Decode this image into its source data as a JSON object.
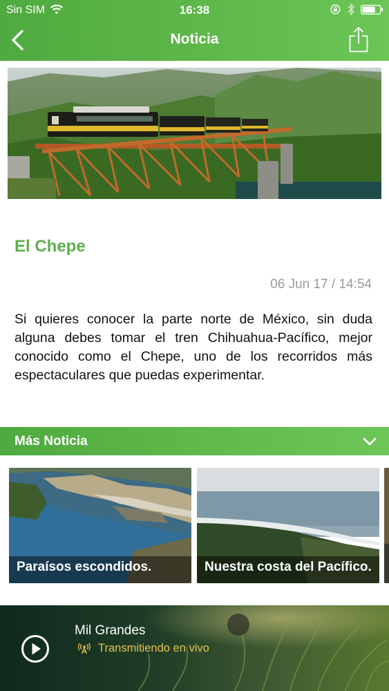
{
  "status_bar": {
    "carrier": "Sin SIM",
    "time": "16:38",
    "icons": [
      "wifi-icon",
      "orientation-lock-icon",
      "bluetooth-icon",
      "battery-icon"
    ]
  },
  "nav": {
    "title": "Noticia",
    "back_icon": "chevron-left-icon",
    "share_icon": "share-icon"
  },
  "article": {
    "title": "El Chepe",
    "date": "06 Jun 17 / 14:54",
    "body": "Si quieres conocer la parte norte de México, sin duda alguna debes tomar el tren Chihuahua-Pacífico, mejor conocido como el Chepe, uno de los recorridos más espectaculares que puedas experimentar."
  },
  "more_news": {
    "label": "Más Noticia",
    "toggle_icon": "chevron-down-icon",
    "items": [
      {
        "caption": "Paraísos escondidos."
      },
      {
        "caption": "Nuestra costa del Pacífico."
      }
    ]
  },
  "player": {
    "station": "Mil Grandes",
    "status": "Transmitiendo en vivo",
    "play_icon": "play-icon",
    "live_icon": "broadcast-icon"
  },
  "colors": {
    "brand_green": "#5fae4b",
    "live_text": "#e8c14a",
    "date_gray": "#9a9a9a"
  }
}
